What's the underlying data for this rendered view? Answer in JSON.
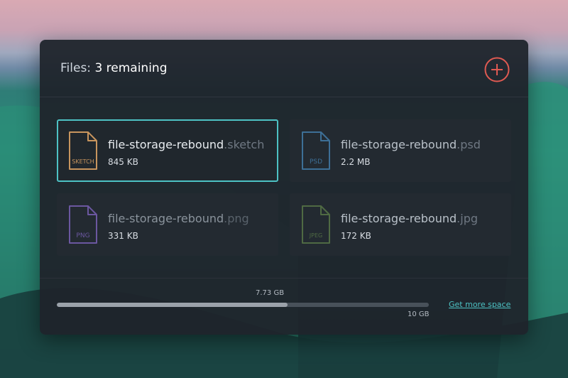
{
  "header": {
    "title_prefix": "Files: ",
    "remaining_text": "3 remaining"
  },
  "files": [
    {
      "base": "file-storage-rebound",
      "ext": ".sketch",
      "size": "845 KB",
      "icon_label": "SKETCH",
      "icon": "sketch-file-icon",
      "color": "#c8955e",
      "selected": true
    },
    {
      "base": "file-storage-rebound",
      "ext": ".psd",
      "size": "2.2 MB",
      "icon_label": "PSD",
      "icon": "psd-file-icon",
      "color": "#3d6f96",
      "selected": false
    },
    {
      "base": "file-storage-rebound",
      "ext": ".png",
      "size": "331 KB",
      "icon_label": "PNG",
      "icon": "png-file-icon",
      "color": "#6b57a0",
      "selected": false
    },
    {
      "base": "file-storage-rebound",
      "ext": ".jpg",
      "size": "172 KB",
      "icon_label": "JPEG",
      "icon": "jpeg-file-icon",
      "color": "#4f6a43",
      "selected": false
    }
  ],
  "storage": {
    "used_label": "7.73 GB",
    "total_label": "10 GB",
    "used_fraction": 0.62,
    "more_link": "Get more space"
  },
  "colors": {
    "accent": "#4dc2c4",
    "add_button": "#e05a52"
  }
}
